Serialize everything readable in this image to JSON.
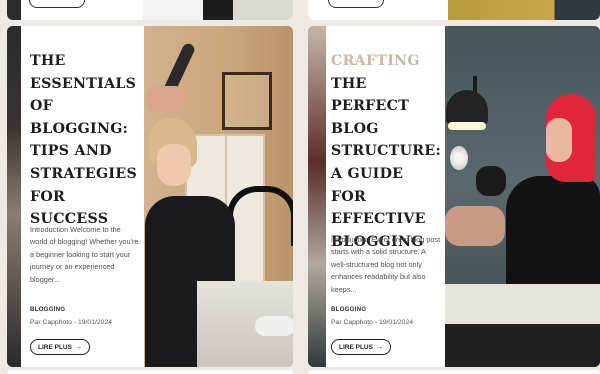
{
  "posts": [
    {
      "title_lines": [
        "THE",
        "ESSENTIALS",
        "OF",
        "BLOGGING:",
        "TIPS AND",
        "STRATEGIES",
        "FOR SUCCESS"
      ],
      "excerpt": "Introduction Welcome to the world of blogging! Whether you're a beginner looking to start your journey or an experienced blogger...",
      "category": "BLOGGING",
      "meta": "Par Capphoto - 19/01/2024",
      "button_label": "LIRE PLUS",
      "image_alt": "hairdresser styling a client's hair in a salon"
    },
    {
      "title_lines": [
        "CRAFTING",
        "THE",
        "PERFECT",
        "BLOG",
        "STRUCTURE:",
        "A GUIDE FOR",
        "EFFECTIVE",
        "BLOGGING"
      ],
      "excerpt": "Introduction Every great blog post starts with a solid structure. A well-structured blog not only enhances readability but also keeps...",
      "category": "BLOGGING",
      "meta": "Par Capphoto - 19/01/2024",
      "button_label": "LIRE PLUS",
      "image_alt": "nail technician with red hair working at a desk lamp"
    }
  ],
  "colors": {
    "background": "#efe9e3",
    "card": "#ffffff",
    "text": "#1d1d1d",
    "faded_text": "#c9b8a8"
  },
  "icons": {
    "button_arrow": "arrow-right-icon"
  }
}
